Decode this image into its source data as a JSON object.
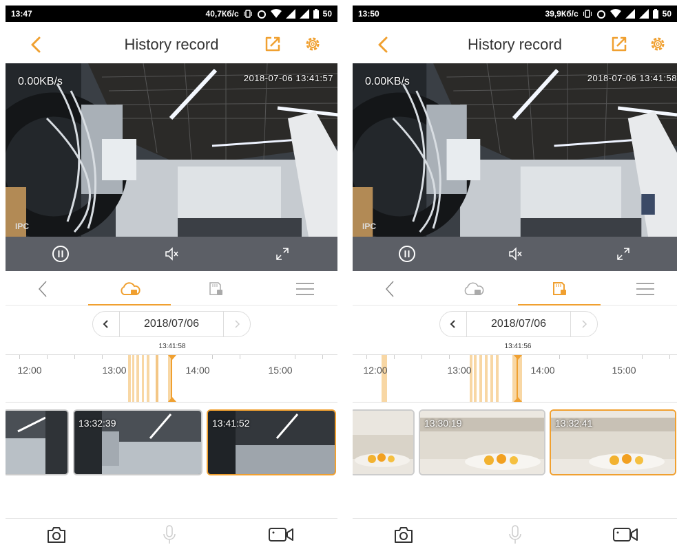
{
  "screens": [
    {
      "status": {
        "time": "13:47",
        "net": "40,7Кб/с",
        "battery": "50"
      },
      "title": "History record",
      "video": {
        "speed": "0.00KB/s",
        "timestamp": "2018-07-06 13:41:57",
        "watermark": "IPC",
        "scene": "office"
      },
      "date": "2018/07/06",
      "active_tab": "cloud",
      "timeline": {
        "current": "13:41:58",
        "hours": [
          "12:00",
          "13:00",
          "14:00",
          "15:00"
        ]
      },
      "thumbs": [
        "",
        "13:32:39",
        "13:41:52"
      ]
    },
    {
      "status": {
        "time": "13:50",
        "net": "39,9Кб/с",
        "battery": "50"
      },
      "title": "History record",
      "video": {
        "speed": "0.00KB/s",
        "timestamp": "2018-07-06 13:41:58",
        "watermark": "IPC",
        "scene": "office"
      },
      "date": "2018/07/06",
      "active_tab": "sd-card",
      "timeline": {
        "current": "13:41:56",
        "hours": [
          "12:00",
          "13:00",
          "14:00",
          "15:00"
        ]
      },
      "thumbs": [
        "",
        "13:30:19",
        "13:32:41"
      ]
    }
  ],
  "colors": {
    "accent": "#f0a030",
    "control_bar": "#5c5f66"
  }
}
